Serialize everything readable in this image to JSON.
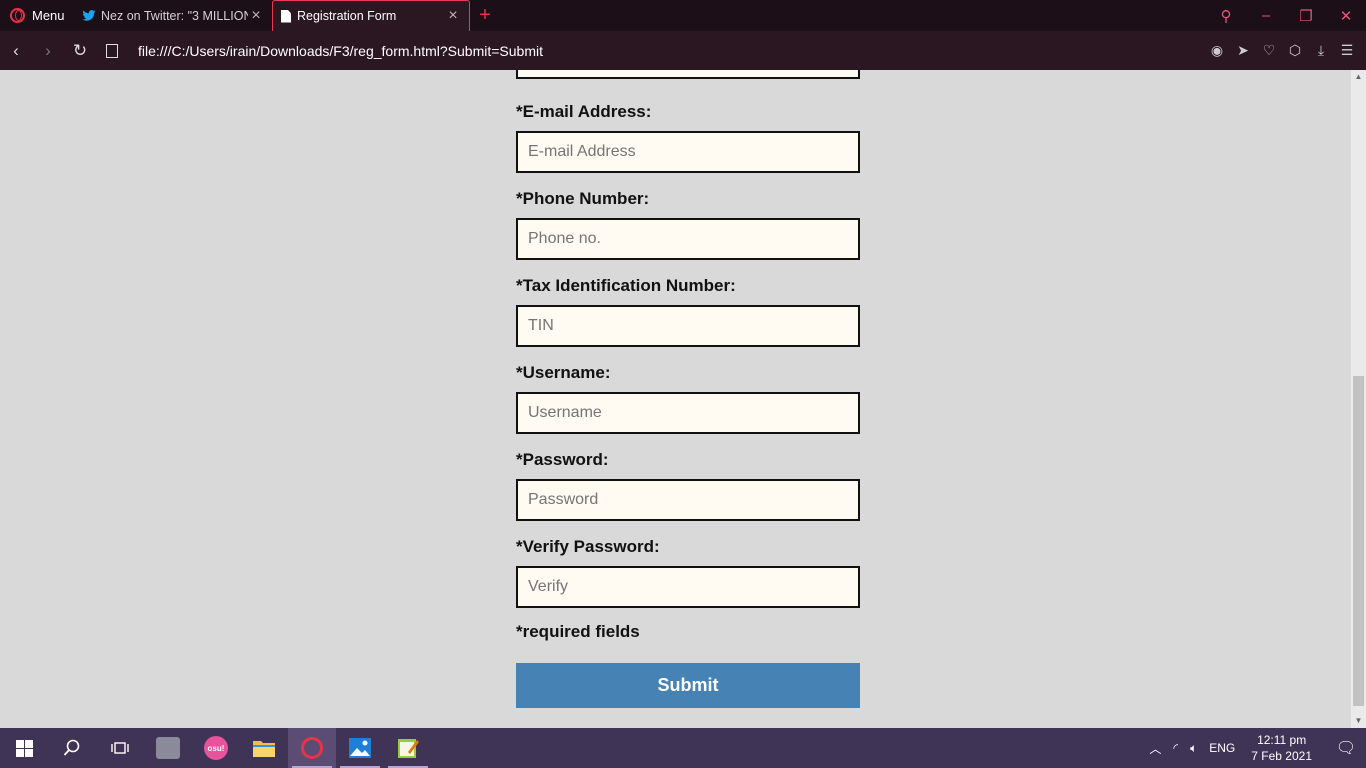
{
  "browser": {
    "menu_label": "Menu",
    "tabs": [
      {
        "title": "Nez on Twitter: \"3 MILLION",
        "active": false
      },
      {
        "title": "Registration Form",
        "active": true
      }
    ],
    "url": "file:///C:/Users/irain/Downloads/F3/reg_form.html?Submit=Submit"
  },
  "form": {
    "fields": [
      {
        "label": "*E-mail Address:",
        "placeholder": "E-mail Address"
      },
      {
        "label": "*Phone Number:",
        "placeholder": "Phone no."
      },
      {
        "label": "*Tax Identification Number:",
        "placeholder": "TIN"
      },
      {
        "label": "*Username:",
        "placeholder": "Username"
      },
      {
        "label": "*Password:",
        "placeholder": "Password"
      },
      {
        "label": "*Verify Password:",
        "placeholder": "Verify"
      }
    ],
    "required_note": "*required fields",
    "submit_label": "Submit"
  },
  "taskbar": {
    "language": "ENG",
    "time": "12:11 pm",
    "date": "7 Feb 2021"
  },
  "colors": {
    "accent": "#e8334a",
    "submit": "#4682b4",
    "page_bg": "#d9d9d9",
    "input_bg": "#fffbf2"
  }
}
